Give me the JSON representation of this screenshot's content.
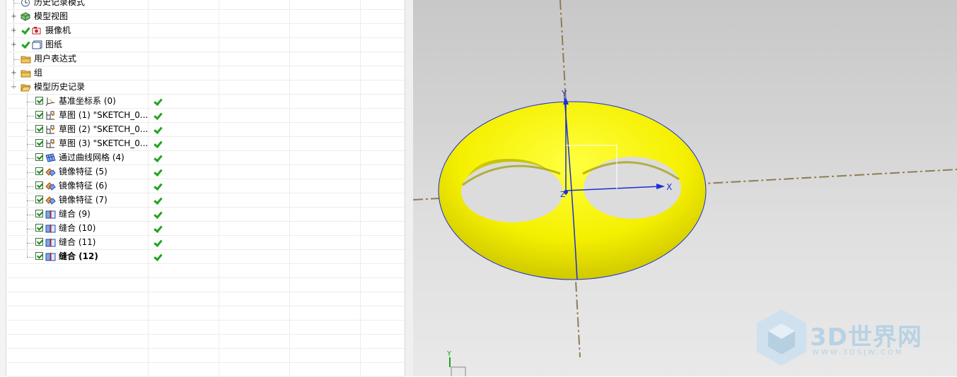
{
  "navigator": {
    "rows": [
      {
        "label": "历史记录模式",
        "icon": "clock-icon"
      },
      {
        "label": "模型视图",
        "icon": "model-views-icon"
      },
      {
        "label": "摄像机",
        "icon": "camera-icon"
      },
      {
        "label": "图纸",
        "icon": "drawing-sheet-icon"
      },
      {
        "label": "用户表达式",
        "icon": "folder-icon"
      },
      {
        "label": "组",
        "icon": "folder-icon"
      },
      {
        "label": "模型历史记录",
        "icon": "open-folder-icon"
      },
      {
        "label": "基准坐标系 (0)",
        "icon": "datum-csys-icon"
      },
      {
        "label": "草图 (1) \"SKETCH_0...",
        "icon": "sketch-icon"
      },
      {
        "label": "草图 (2) \"SKETCH_0...",
        "icon": "sketch-icon"
      },
      {
        "label": "草图 (3) \"SKETCH_0...",
        "icon": "sketch-icon"
      },
      {
        "label": "通过曲线网格 (4)",
        "icon": "through-curve-mesh-icon"
      },
      {
        "label": "镜像特征 (5)",
        "icon": "mirror-feature-icon"
      },
      {
        "label": "镜像特征 (6)",
        "icon": "mirror-feature-icon"
      },
      {
        "label": "镜像特征 (7)",
        "icon": "mirror-feature-icon"
      },
      {
        "label": "缝合 (9)",
        "icon": "sew-icon"
      },
      {
        "label": "缝合 (10)",
        "icon": "sew-icon"
      },
      {
        "label": "缝合 (11)",
        "icon": "sew-icon"
      },
      {
        "label": "缝合 (12)",
        "icon": "sew-icon"
      }
    ]
  },
  "viewport": {
    "axes": {
      "x_label": "X",
      "y_label": "Y",
      "z_label": "Z",
      "mini_y_label": "Y"
    },
    "part_color": "#f5f500",
    "axis_color": "#1a2fd6",
    "datum_line_color": "#8c7e55"
  },
  "watermark": {
    "title": "3D世界网",
    "subtitle": "WWW.3DSJW.COM",
    "color": "#b8d2e4"
  }
}
